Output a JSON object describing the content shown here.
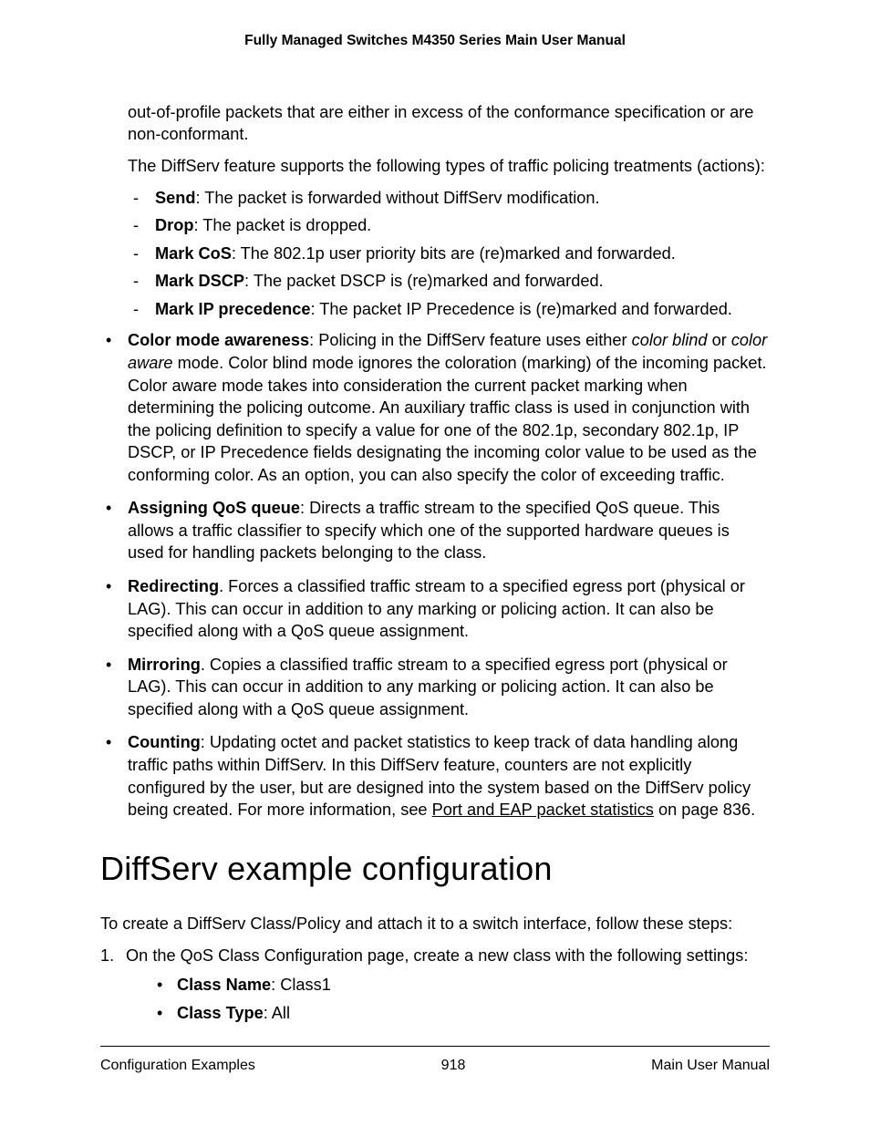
{
  "header": {
    "title": "Fully Managed Switches M4350 Series Main User Manual"
  },
  "content": {
    "p1": "out-of-profile packets that are either in excess of the conformance specification or are non-conformant.",
    "p2": "The DiffServ feature supports the following types of traffic policing treatments (actions):",
    "actions": [
      {
        "term": "Send",
        "desc": ": The packet is forwarded without DiffServ modification."
      },
      {
        "term": "Drop",
        "desc": ": The packet is dropped."
      },
      {
        "term": "Mark CoS",
        "desc": ": The 802.1p user priority bits are (re)marked and forwarded."
      },
      {
        "term": "Mark DSCP",
        "desc": ": The packet DSCP is (re)marked and forwarded."
      },
      {
        "term": "Mark IP precedence",
        "desc": ": The packet IP Precedence is (re)marked and forwarded."
      }
    ],
    "bullets": [
      {
        "term": "Color mode awareness",
        "lead": ": Policing in the DiffServ feature uses either ",
        "ital1": "color blind",
        "mid": " or ",
        "ital2": "color aware",
        "tail": " mode. Color blind mode ignores the coloration (marking) of the incoming packet. Color aware mode takes into consideration the current packet marking when determining the policing outcome. An auxiliary traffic class is used in conjunction with the policing definition to specify a value for one of the 802.1p, secondary 802.1p, IP DSCP, or IP Precedence fields designating the incoming color value to be used as the conforming color. As an option, you can also specify the color of exceeding traffic."
      },
      {
        "term": "Assigning QoS queue",
        "lead": ": Directs a traffic stream to the specified QoS queue. This allows a traffic classifier to specify which one of the supported hardware queues is used for handling packets belonging to the class."
      },
      {
        "term": "Redirecting",
        "lead": ". Forces a classified traffic stream to a specified egress port (physical or LAG). This can occur in addition to any marking or policing action. It can also be specified along with a QoS queue assignment."
      },
      {
        "term": "Mirroring",
        "lead": ". Copies a classified traffic stream to a specified egress port (physical or LAG). This can occur in addition to any marking or policing action. It can also be specified along with a QoS queue assignment."
      },
      {
        "term": "Counting",
        "lead": ": Updating octet and packet statistics to keep track of data handling along traffic paths within DiffServ. In this DiffServ feature, counters are not explicitly configured by the user, but are designed into the system based on the DiffServ policy being created. For more information, see ",
        "link": "Port and EAP packet statistics",
        "tail2": " on page 836."
      }
    ],
    "section_heading": "DiffServ example configuration",
    "p3": "To create a DiffServ Class/Policy and attach it to a switch interface, follow these steps:",
    "steps": [
      {
        "text": "On the QoS Class Configuration page, create a new class with the following settings:",
        "sub": [
          {
            "term": "Class Name",
            "desc": ": Class1"
          },
          {
            "term": "Class Type",
            "desc": ": All"
          }
        ]
      }
    ]
  },
  "footer": {
    "left": "Configuration Examples",
    "center": "918",
    "right": "Main User Manual"
  }
}
